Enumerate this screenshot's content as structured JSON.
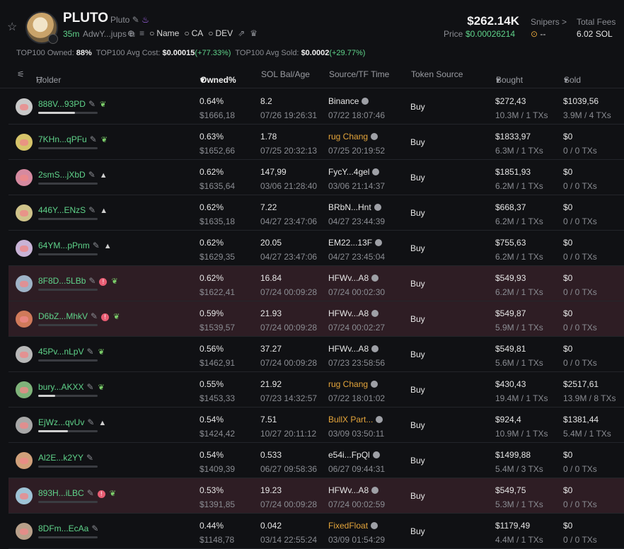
{
  "token": {
    "name": "PLUTO",
    "sub": "Pluto",
    "age": "35m",
    "address": "AdwY...jups",
    "links": [
      "Name",
      "CA",
      "DEV"
    ],
    "market_cap": "$262.14K",
    "price_label": "Price",
    "price": "$0.00026214",
    "snipers_label": "Snipers >",
    "snipers_value": "--",
    "fees_label": "Total Fees",
    "fees_value": "6.02 SOL"
  },
  "stats": {
    "owned_label": "TOP100 Owned:",
    "owned": "88%",
    "avg_cost_label": "TOP100 Avg Cost:",
    "avg_cost": "$0.00015",
    "avg_cost_change": "(+77.33%)",
    "avg_sold_label": "TOP100 Avg Sold:",
    "avg_sold": "$0.0002",
    "avg_sold_change": "(+29.77%)"
  },
  "columns": {
    "holder": "Holder",
    "owned": "Owned%",
    "sol": "SOL Bal/Age",
    "source": "Source/TF Time",
    "token_source": "Token Source",
    "bought": "Bought",
    "sold": "Sold"
  },
  "rows": [
    {
      "name": "888V...93PD",
      "tag": "leaf",
      "flag": false,
      "bar": 0.62,
      "pct": "0.64%",
      "usd": "$1666,18",
      "sol": "8.2",
      "sol_time": "07/26 19:26:31",
      "src": "Binance",
      "src_time": "07/22 18:07:46",
      "src_orange": false,
      "tok": "Buy",
      "buy": "$272,43",
      "buy_tx": "10.3M / 1 TXs",
      "sold": "$1039,56",
      "sold_tx": "3.9M / 4 TXs",
      "hl": false
    },
    {
      "name": "7KHn...qPFu",
      "tag": "leaf",
      "flag": false,
      "bar": 0.0,
      "pct": "0.63%",
      "usd": "$1652,66",
      "sol": "1.78",
      "sol_time": "07/25 20:32:13",
      "src": "rug Chang",
      "src_time": "07/25 20:19:52",
      "src_orange": true,
      "tok": "Buy",
      "buy": "$1833,97",
      "buy_tx": "6.3M / 1 TXs",
      "sold": "$0",
      "sold_tx": "0 / 0 TXs",
      "hl": false
    },
    {
      "name": "2smS...jXbD",
      "tag": "tri",
      "flag": false,
      "bar": 0.0,
      "pct": "0.62%",
      "usd": "$1635,64",
      "sol": "147,99",
      "sol_time": "03/06 21:28:40",
      "src": "FycY...4gel",
      "src_time": "03/06 21:14:37",
      "src_orange": false,
      "tok": "Buy",
      "buy": "$1851,93",
      "buy_tx": "6.2M / 1 TXs",
      "sold": "$0",
      "sold_tx": "0 / 0 TXs",
      "hl": false
    },
    {
      "name": "446Y...ENzS",
      "tag": "tri",
      "flag": false,
      "bar": 0.0,
      "pct": "0.62%",
      "usd": "$1635,18",
      "sol": "7.22",
      "sol_time": "04/27 23:47:06",
      "src": "BRbN...Hnt",
      "src_time": "04/27 23:44:39",
      "src_orange": false,
      "tok": "Buy",
      "buy": "$668,37",
      "buy_tx": "6.2M / 1 TXs",
      "sold": "$0",
      "sold_tx": "0 / 0 TXs",
      "hl": false
    },
    {
      "name": "64YM...pPnm",
      "tag": "tri",
      "flag": false,
      "bar": 0.0,
      "pct": "0.62%",
      "usd": "$1629,35",
      "sol": "20.05",
      "sol_time": "04/27 23:47:06",
      "src": "EM22...13F",
      "src_time": "04/27 23:45:04",
      "src_orange": false,
      "tok": "Buy",
      "buy": "$755,63",
      "buy_tx": "6.2M / 1 TXs",
      "sold": "$0",
      "sold_tx": "0 / 0 TXs",
      "hl": false
    },
    {
      "name": "8F8D...5LBb",
      "tag": "leaf",
      "flag": true,
      "bar": 0.0,
      "pct": "0.62%",
      "usd": "$1622,41",
      "sol": "16.84",
      "sol_time": "07/24 00:09:28",
      "src": "HFWv...A8",
      "src_time": "07/24 00:02:30",
      "src_orange": false,
      "tok": "Buy",
      "buy": "$549,93",
      "buy_tx": "6.2M / 1 TXs",
      "sold": "$0",
      "sold_tx": "0 / 0 TXs",
      "hl": true
    },
    {
      "name": "D6bZ...MhkV",
      "tag": "leaf",
      "flag": true,
      "bar": 0.0,
      "pct": "0.59%",
      "usd": "$1539,57",
      "sol": "21.93",
      "sol_time": "07/24 00:09:28",
      "src": "HFWv...A8",
      "src_time": "07/24 00:02:27",
      "src_orange": false,
      "tok": "Buy",
      "buy": "$549,87",
      "buy_tx": "5.9M / 1 TXs",
      "sold": "$0",
      "sold_tx": "0 / 0 TXs",
      "hl": true
    },
    {
      "name": "45Pv...nLpV",
      "tag": "leaf",
      "flag": false,
      "bar": 0.0,
      "pct": "0.56%",
      "usd": "$1462,91",
      "sol": "37.27",
      "sol_time": "07/24 00:09:28",
      "src": "HFWv...A8",
      "src_time": "07/23 23:58:56",
      "src_orange": false,
      "tok": "Buy",
      "buy": "$549,81",
      "buy_tx": "5.6M / 1 TXs",
      "sold": "$0",
      "sold_tx": "0 / 0 TXs",
      "hl": false
    },
    {
      "name": "bury...AKXX",
      "tag": "leaf",
      "flag": false,
      "bar": 0.28,
      "pct": "0.55%",
      "usd": "$1453,33",
      "sol": "21.92",
      "sol_time": "07/23 14:32:57",
      "src": "rug Chang",
      "src_time": "07/22 18:01:02",
      "src_orange": true,
      "tok": "Buy",
      "buy": "$430,43",
      "buy_tx": "19.4M / 1 TXs",
      "sold": "$2517,61",
      "sold_tx": "13.9M / 8 TXs",
      "hl": false
    },
    {
      "name": "EjWz...qvUv",
      "tag": "tri",
      "flag": false,
      "bar": 0.5,
      "pct": "0.54%",
      "usd": "$1424,42",
      "sol": "7.51",
      "sol_time": "10/27 20:11:12",
      "src": "BullX Part...",
      "src_time": "03/09 03:50:11",
      "src_orange": true,
      "tok": "Buy",
      "buy": "$924,4",
      "buy_tx": "10.9M / 1 TXs",
      "sold": "$1381,44",
      "sold_tx": "5.4M / 1 TXs",
      "hl": false
    },
    {
      "name": "Al2E...k2YY",
      "tag": "none",
      "flag": false,
      "bar": 0.0,
      "pct": "0.54%",
      "usd": "$1409,39",
      "sol": "0.533",
      "sol_time": "06/27 09:58:36",
      "src": "e54i...FpQl",
      "src_time": "06/27 09:44:31",
      "src_orange": false,
      "tok": "Buy",
      "buy": "$1499,88",
      "buy_tx": "5.4M / 3 TXs",
      "sold": "$0",
      "sold_tx": "0 / 0 TXs",
      "hl": false
    },
    {
      "name": "893H...iLBC",
      "tag": "leaf",
      "flag": true,
      "bar": 0.0,
      "pct": "0.53%",
      "usd": "$1391,85",
      "sol": "19.23",
      "sol_time": "07/24 00:09:28",
      "src": "HFWv...A8",
      "src_time": "07/24 00:02:59",
      "src_orange": false,
      "tok": "Buy",
      "buy": "$549,75",
      "buy_tx": "5.3M / 1 TXs",
      "sold": "$0",
      "sold_tx": "0 / 0 TXs",
      "hl": true
    },
    {
      "name": "8DFm...EcAa",
      "tag": "none",
      "flag": false,
      "bar": 0.0,
      "pct": "0.44%",
      "usd": "$1148,78",
      "sol": "0.042",
      "sol_time": "03/14 22:55:24",
      "src": "FixedFloat",
      "src_time": "03/09 01:54:29",
      "src_orange": true,
      "tok": "Buy",
      "buy": "$1179,49",
      "buy_tx": "4.4M / 1 TXs",
      "sold": "$0",
      "sold_tx": "0 / 0 TXs",
      "hl": false
    }
  ]
}
